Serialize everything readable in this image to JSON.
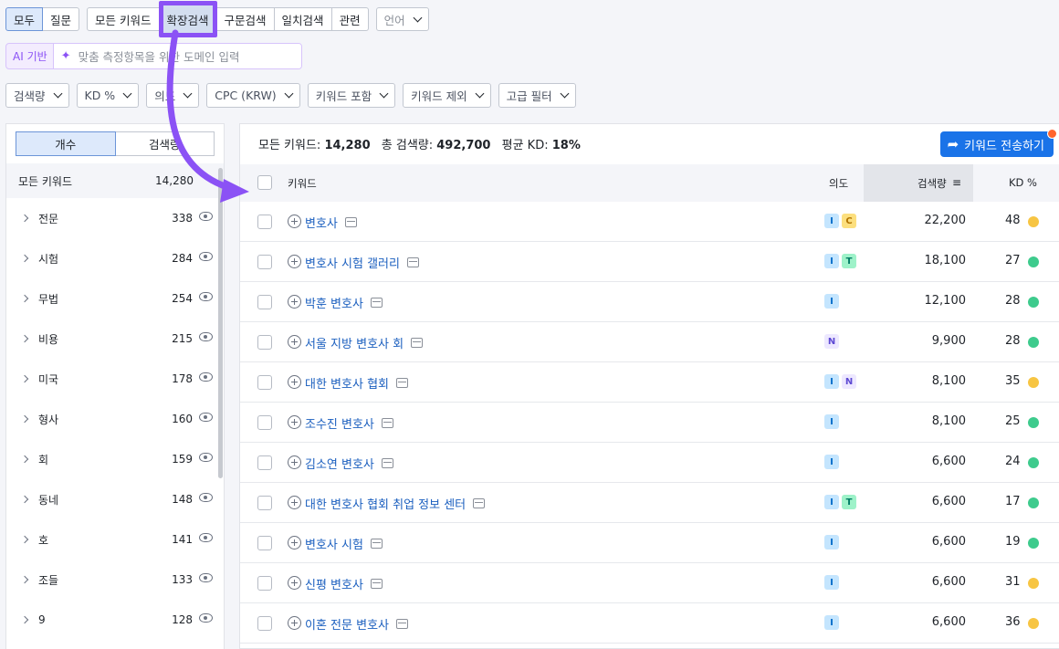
{
  "tabs_group1": [
    "모두",
    "질문"
  ],
  "tabs_group2": [
    "모든 키워드",
    "확장검색",
    "구문검색",
    "일치검색",
    "관련"
  ],
  "language_label": "언어",
  "ai": {
    "label": "AI 기반",
    "placeholder": "맞춤 측정항목을 위한 도메인 입력"
  },
  "filters": [
    "검색량",
    "KD %",
    "의도",
    "CPC (KRW)",
    "키워드 포함",
    "키워드 제외",
    "고급 필터"
  ],
  "sidebar": {
    "toggle": [
      "개수",
      "검색량"
    ],
    "header": {
      "label": "모든 키워드",
      "count": "14,280"
    },
    "items": [
      {
        "label": "전문",
        "count": "338"
      },
      {
        "label": "시험",
        "count": "284"
      },
      {
        "label": "무법",
        "count": "254"
      },
      {
        "label": "비용",
        "count": "215"
      },
      {
        "label": "미국",
        "count": "178"
      },
      {
        "label": "형사",
        "count": "160"
      },
      {
        "label": "회",
        "count": "159"
      },
      {
        "label": "동네",
        "count": "148"
      },
      {
        "label": "호",
        "count": "141"
      },
      {
        "label": "조들",
        "count": "133"
      },
      {
        "label": "9",
        "count": "128"
      }
    ]
  },
  "summary": {
    "all_label": "모든 키워드:",
    "all_value": "14,280",
    "volume_label": "총 검색량:",
    "volume_value": "492,700",
    "kd_label": "평균 KD:",
    "kd_value": "18%"
  },
  "export_label": "키워드 전송하기",
  "columns": {
    "keyword": "키워드",
    "intent": "의도",
    "volume": "검색량",
    "kd": "KD %"
  },
  "colors": {
    "kd_green": "#3ecb8d",
    "kd_yellow": "#f7c543",
    "accent": "#8b52f5",
    "link": "#1b5fbf"
  },
  "rows": [
    {
      "keyword": "변호사",
      "intents": [
        "I",
        "C"
      ],
      "volume": "22,200",
      "kd": "48",
      "kd_color": "#f7c543"
    },
    {
      "keyword": "변호사 시험 갤러리",
      "intents": [
        "I",
        "T"
      ],
      "volume": "18,100",
      "kd": "27",
      "kd_color": "#3ecb8d"
    },
    {
      "keyword": "박훈 변호사",
      "intents": [
        "I"
      ],
      "volume": "12,100",
      "kd": "28",
      "kd_color": "#3ecb8d"
    },
    {
      "keyword": "서울 지방 변호사 회",
      "intents": [
        "N"
      ],
      "volume": "9,900",
      "kd": "28",
      "kd_color": "#3ecb8d"
    },
    {
      "keyword": "대한 변호사 협회",
      "intents": [
        "I",
        "N"
      ],
      "volume": "8,100",
      "kd": "35",
      "kd_color": "#f7c543"
    },
    {
      "keyword": "조수진 변호사",
      "intents": [
        "I"
      ],
      "volume": "8,100",
      "kd": "25",
      "kd_color": "#3ecb8d"
    },
    {
      "keyword": "김소연 변호사",
      "intents": [
        "I"
      ],
      "volume": "6,600",
      "kd": "24",
      "kd_color": "#3ecb8d"
    },
    {
      "keyword": "대한 변호사 협회 취업 정보 센터",
      "intents": [
        "I",
        "T"
      ],
      "volume": "6,600",
      "kd": "17",
      "kd_color": "#3ecb8d"
    },
    {
      "keyword": "변호사 시험",
      "intents": [
        "I"
      ],
      "volume": "6,600",
      "kd": "19",
      "kd_color": "#3ecb8d"
    },
    {
      "keyword": "신평 변호사",
      "intents": [
        "I"
      ],
      "volume": "6,600",
      "kd": "31",
      "kd_color": "#f7c543"
    },
    {
      "keyword": "이혼 전문 변호사",
      "intents": [
        "I"
      ],
      "volume": "6,600",
      "kd": "36",
      "kd_color": "#f7c543"
    }
  ]
}
